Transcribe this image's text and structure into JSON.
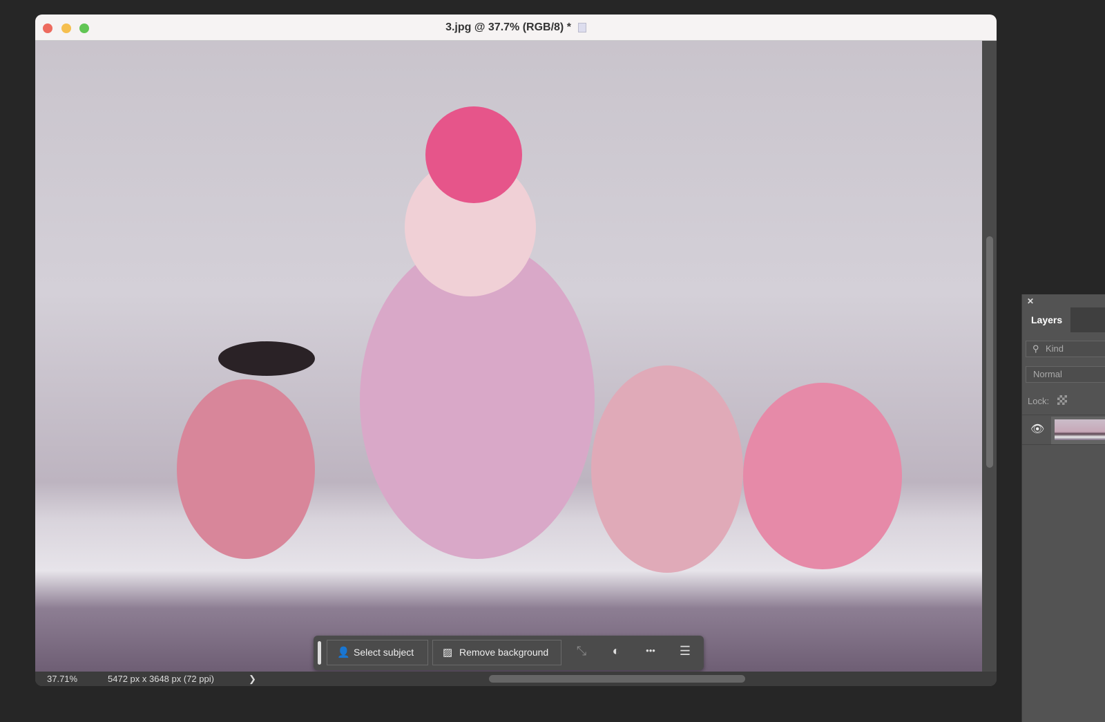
{
  "window": {
    "title": "3.jpg @ 37.7% (RGB/8) *",
    "traffic_lights": {
      "close": "#ed6a5e",
      "minimize": "#f5bf4f",
      "zoom": "#61c554"
    }
  },
  "status": {
    "zoom": "37.71%",
    "dimensions": "5472 px x 3648 px (72 ppi)",
    "arrow": "❯"
  },
  "toolbar": {
    "select_subject": "Select subject",
    "remove_background": "Remove background",
    "more": "•••"
  },
  "layers_panel": {
    "close": "✕",
    "tab": "Layers",
    "kind_placeholder": "Kind",
    "blend_mode": "Normal",
    "lock_label": "Lock:"
  }
}
